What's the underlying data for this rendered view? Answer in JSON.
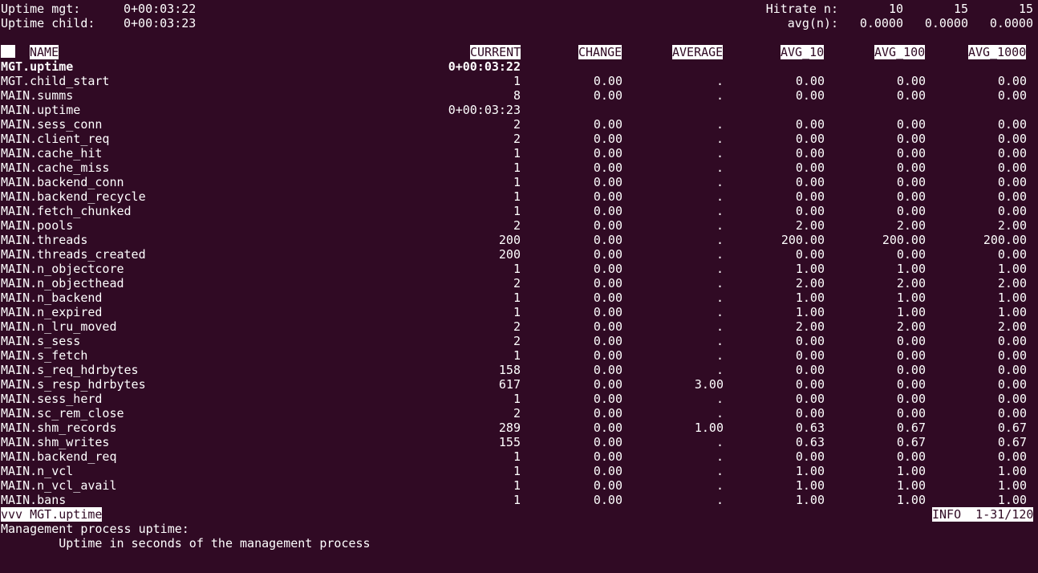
{
  "uptime": {
    "mgt_label": "Uptime mgt:",
    "mgt_value": "0+00:03:22",
    "child_label": "Uptime child:",
    "child_value": "0+00:03:23"
  },
  "hitrate": {
    "n_label": "Hitrate n:",
    "n_values": [
      "10",
      "15",
      "15"
    ],
    "avg_label": "avg(n):",
    "avg_values": [
      "0.0000",
      "0.0000",
      "0.0000"
    ]
  },
  "columns": {
    "name": "NAME",
    "current": "CURRENT",
    "change": "CHANGE",
    "average": "AVERAGE",
    "avg_10": "AVG_10",
    "avg_100": "AVG_100",
    "avg_1000": "AVG_1000"
  },
  "rows": [
    {
      "name": "MGT.uptime",
      "current": "0+00:03:22",
      "change": "",
      "average": "",
      "avg_10": "",
      "avg_100": "",
      "avg_1000": "",
      "bold": true
    },
    {
      "name": "MGT.child_start",
      "current": "1",
      "change": "0.00",
      "average": ".",
      "avg_10": "0.00",
      "avg_100": "0.00",
      "avg_1000": "0.00"
    },
    {
      "name": "MAIN.summs",
      "current": "8",
      "change": "0.00",
      "average": ".",
      "avg_10": "0.00",
      "avg_100": "0.00",
      "avg_1000": "0.00"
    },
    {
      "name": "MAIN.uptime",
      "current": "0+00:03:23",
      "change": "",
      "average": "",
      "avg_10": "",
      "avg_100": "",
      "avg_1000": ""
    },
    {
      "name": "MAIN.sess_conn",
      "current": "2",
      "change": "0.00",
      "average": ".",
      "avg_10": "0.00",
      "avg_100": "0.00",
      "avg_1000": "0.00"
    },
    {
      "name": "MAIN.client_req",
      "current": "2",
      "change": "0.00",
      "average": ".",
      "avg_10": "0.00",
      "avg_100": "0.00",
      "avg_1000": "0.00"
    },
    {
      "name": "MAIN.cache_hit",
      "current": "1",
      "change": "0.00",
      "average": ".",
      "avg_10": "0.00",
      "avg_100": "0.00",
      "avg_1000": "0.00"
    },
    {
      "name": "MAIN.cache_miss",
      "current": "1",
      "change": "0.00",
      "average": ".",
      "avg_10": "0.00",
      "avg_100": "0.00",
      "avg_1000": "0.00"
    },
    {
      "name": "MAIN.backend_conn",
      "current": "1",
      "change": "0.00",
      "average": ".",
      "avg_10": "0.00",
      "avg_100": "0.00",
      "avg_1000": "0.00"
    },
    {
      "name": "MAIN.backend_recycle",
      "current": "1",
      "change": "0.00",
      "average": ".",
      "avg_10": "0.00",
      "avg_100": "0.00",
      "avg_1000": "0.00"
    },
    {
      "name": "MAIN.fetch_chunked",
      "current": "1",
      "change": "0.00",
      "average": ".",
      "avg_10": "0.00",
      "avg_100": "0.00",
      "avg_1000": "0.00"
    },
    {
      "name": "MAIN.pools",
      "current": "2",
      "change": "0.00",
      "average": ".",
      "avg_10": "2.00",
      "avg_100": "2.00",
      "avg_1000": "2.00"
    },
    {
      "name": "MAIN.threads",
      "current": "200",
      "change": "0.00",
      "average": ".",
      "avg_10": "200.00",
      "avg_100": "200.00",
      "avg_1000": "200.00"
    },
    {
      "name": "MAIN.threads_created",
      "current": "200",
      "change": "0.00",
      "average": ".",
      "avg_10": "0.00",
      "avg_100": "0.00",
      "avg_1000": "0.00"
    },
    {
      "name": "MAIN.n_objectcore",
      "current": "1",
      "change": "0.00",
      "average": ".",
      "avg_10": "1.00",
      "avg_100": "1.00",
      "avg_1000": "1.00"
    },
    {
      "name": "MAIN.n_objecthead",
      "current": "2",
      "change": "0.00",
      "average": ".",
      "avg_10": "2.00",
      "avg_100": "2.00",
      "avg_1000": "2.00"
    },
    {
      "name": "MAIN.n_backend",
      "current": "1",
      "change": "0.00",
      "average": ".",
      "avg_10": "1.00",
      "avg_100": "1.00",
      "avg_1000": "1.00"
    },
    {
      "name": "MAIN.n_expired",
      "current": "1",
      "change": "0.00",
      "average": ".",
      "avg_10": "1.00",
      "avg_100": "1.00",
      "avg_1000": "1.00"
    },
    {
      "name": "MAIN.n_lru_moved",
      "current": "2",
      "change": "0.00",
      "average": ".",
      "avg_10": "2.00",
      "avg_100": "2.00",
      "avg_1000": "2.00"
    },
    {
      "name": "MAIN.s_sess",
      "current": "2",
      "change": "0.00",
      "average": ".",
      "avg_10": "0.00",
      "avg_100": "0.00",
      "avg_1000": "0.00"
    },
    {
      "name": "MAIN.s_fetch",
      "current": "1",
      "change": "0.00",
      "average": ".",
      "avg_10": "0.00",
      "avg_100": "0.00",
      "avg_1000": "0.00"
    },
    {
      "name": "MAIN.s_req_hdrbytes",
      "current": "158",
      "change": "0.00",
      "average": ".",
      "avg_10": "0.00",
      "avg_100": "0.00",
      "avg_1000": "0.00"
    },
    {
      "name": "MAIN.s_resp_hdrbytes",
      "current": "617",
      "change": "0.00",
      "average": "3.00",
      "avg_10": "0.00",
      "avg_100": "0.00",
      "avg_1000": "0.00"
    },
    {
      "name": "MAIN.sess_herd",
      "current": "1",
      "change": "0.00",
      "average": ".",
      "avg_10": "0.00",
      "avg_100": "0.00",
      "avg_1000": "0.00"
    },
    {
      "name": "MAIN.sc_rem_close",
      "current": "2",
      "change": "0.00",
      "average": ".",
      "avg_10": "0.00",
      "avg_100": "0.00",
      "avg_1000": "0.00"
    },
    {
      "name": "MAIN.shm_records",
      "current": "289",
      "change": "0.00",
      "average": "1.00",
      "avg_10": "0.63",
      "avg_100": "0.67",
      "avg_1000": "0.67"
    },
    {
      "name": "MAIN.shm_writes",
      "current": "155",
      "change": "0.00",
      "average": ".",
      "avg_10": "0.63",
      "avg_100": "0.67",
      "avg_1000": "0.67"
    },
    {
      "name": "MAIN.backend_req",
      "current": "1",
      "change": "0.00",
      "average": ".",
      "avg_10": "0.00",
      "avg_100": "0.00",
      "avg_1000": "0.00"
    },
    {
      "name": "MAIN.n_vcl",
      "current": "1",
      "change": "0.00",
      "average": ".",
      "avg_10": "1.00",
      "avg_100": "1.00",
      "avg_1000": "1.00"
    },
    {
      "name": "MAIN.n_vcl_avail",
      "current": "1",
      "change": "0.00",
      "average": ".",
      "avg_10": "1.00",
      "avg_100": "1.00",
      "avg_1000": "1.00"
    },
    {
      "name": "MAIN.bans",
      "current": "1",
      "change": "0.00",
      "average": ".",
      "avg_10": "1.00",
      "avg_100": "1.00",
      "avg_1000": "1.00"
    }
  ],
  "status_bar": {
    "selected": "vvv MGT.uptime",
    "info": "INFO  1-31/120"
  },
  "description": {
    "title": "Management process uptime:",
    "detail": "        Uptime in seconds of the management process"
  },
  "colors": {
    "background": "#300a24",
    "foreground": "#ffffff"
  }
}
